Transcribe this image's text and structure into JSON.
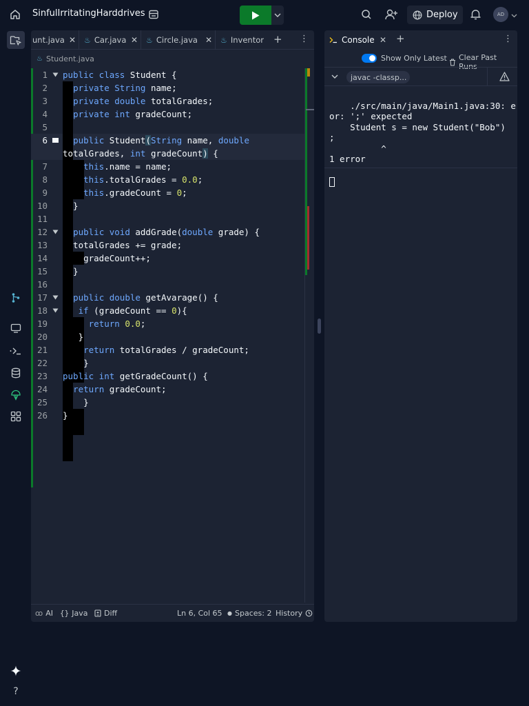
{
  "topbar": {
    "title": "SinfulIrritatingHarddrives",
    "deploy_label": "Deploy",
    "avatar_initials": "AD"
  },
  "editor": {
    "tabs": [
      {
        "label": "unt.java"
      },
      {
        "label": "Car.java"
      },
      {
        "label": "Circle.java"
      },
      {
        "label": "Inventor"
      }
    ],
    "breadcrumb": "Student.java",
    "lines": [
      {
        "n": "1"
      },
      {
        "n": "2"
      },
      {
        "n": "3"
      },
      {
        "n": "4"
      },
      {
        "n": "5"
      },
      {
        "n": "6"
      },
      {
        "n": "7"
      },
      {
        "n": "8"
      },
      {
        "n": "9"
      },
      {
        "n": "10"
      },
      {
        "n": "11"
      },
      {
        "n": "12"
      },
      {
        "n": "13"
      },
      {
        "n": "14"
      },
      {
        "n": "15"
      },
      {
        "n": "16"
      },
      {
        "n": "17"
      },
      {
        "n": "18"
      },
      {
        "n": "19"
      },
      {
        "n": "20"
      },
      {
        "n": "21"
      },
      {
        "n": "22"
      },
      {
        "n": "23"
      },
      {
        "n": "24"
      },
      {
        "n": "25"
      },
      {
        "n": "26"
      }
    ],
    "status": {
      "ai": "AI",
      "language": "Java",
      "diff": "Diff",
      "position": "Ln 6, Col 65",
      "spaces": "Spaces: 2",
      "history": "History"
    }
  },
  "console": {
    "tab_label": "Console",
    "show_only_latest": "Show Only Latest",
    "clear_past_runs": "Clear Past Runs",
    "command": "javac -classp...",
    "output": "./src/main/java/Main1.java:30: err\nor: ';' expected\n    Student s = new Student(\"Bob\")\n;\n          ^\n1 error"
  },
  "colors": {
    "background": "#0e1525",
    "panel": "#1c2333",
    "run_green": "#0b7a2a",
    "keyword_blue": "#6ea8fe",
    "number_yellow": "#d7e36b",
    "toggle_blue": "#0079f2"
  },
  "icons": [
    "home-icon",
    "list-icon",
    "play-icon",
    "chevron-down-icon",
    "search-icon",
    "add-user-icon",
    "globe-icon",
    "bell-icon",
    "files-icon",
    "git-icon",
    "monitor-icon",
    "terminal-icon",
    "database-icon",
    "package-icon",
    "apps-icon",
    "sparkle-icon",
    "help-icon",
    "warning-icon",
    "more-icon",
    "plus-icon",
    "close-icon",
    "trash-icon",
    "java-icon"
  ]
}
